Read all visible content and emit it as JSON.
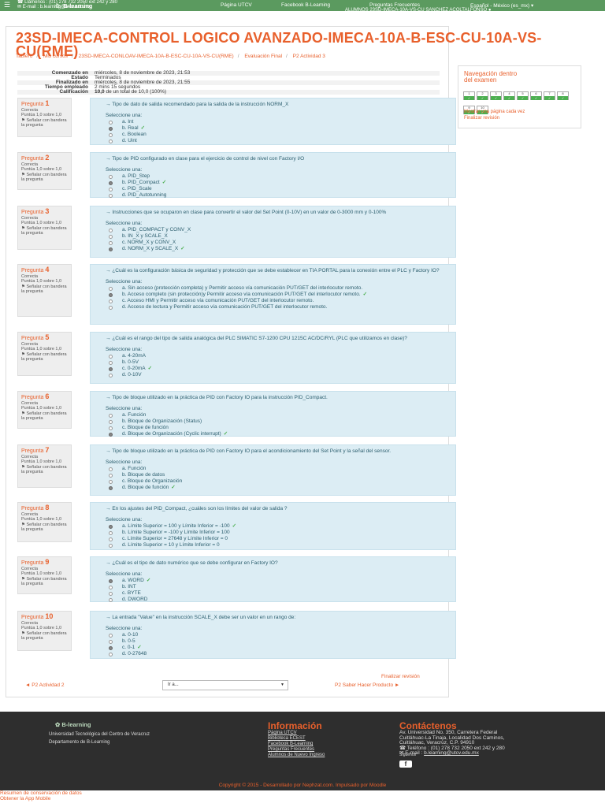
{
  "topbar": {
    "phone": "Llámenos : (01) 278 732 2050 ext 242 y 280",
    "email": "E-mail : b.learning@utcv.edu.mx",
    "brand": "B-learning",
    "nav": [
      "Página UTCV",
      "Facebook B-Learning",
      "Preguntas Frecuentes",
      "Español - México (es_mx)"
    ],
    "user": "ALUMNOS 23SD-IMECA-10A-VS-CU SANCHEZ ACOLTALFONSO"
  },
  "course_title": "23SD-IMECA-CONTROL LOGICO AVANZADO-IMECA-10A-B-ESC-CU-10A-VS-CU(RME)",
  "breadcrumbs": [
    "Tablero",
    "Mis cursos",
    "23SD-IMECA-CONLOAV-IMECA-10A-B-ESC-CU-10A-VS-CU(RME)",
    "Evaluación Final",
    "P2 Actividad 3"
  ],
  "summary": [
    {
      "k": "Comenzado en",
      "v": "miércoles, 8 de noviembre de 2023, 21:53"
    },
    {
      "k": "Estado",
      "v": "Terminados"
    },
    {
      "k": "Finalizado en",
      "v": "miércoles, 8 de noviembre de 2023, 21:55"
    },
    {
      "k": "Tiempo empleado",
      "v": "2 mins 15 segundos"
    },
    {
      "k": "Calificación",
      "v_bold": "10,0",
      "v": " de un total de 10,0 (100%)"
    }
  ],
  "question_meta": {
    "state": "Correcta",
    "points": "Puntúa 1,0 sobre 1,0",
    "flag": "Señalar con bandera la pregunta",
    "prompt": "Seleccione una:",
    "label": "Pregunta"
  },
  "questions": [
    {
      "no": "1",
      "text": "Tipo de dato de salida recomendado para la salida de la instrucción NORM_X",
      "answers": [
        "a. Int",
        "b. Real",
        "c. Boolean",
        "d. Uint"
      ],
      "selected": 1
    },
    {
      "no": "2",
      "text": "Tipo de PID configurado en clase para el ejercicio de control de nivel con Factory I/O",
      "answers": [
        "a. PID_Step",
        "b. PID_Compact",
        "c. PID_Scale",
        "d. PID_Autotunning"
      ],
      "selected": 1
    },
    {
      "no": "3",
      "text": "Instrucciones que se ocuparon en clase para convertir el valor del Set Point (0-10V) en un valor de 0-3000 mm y 0-100%",
      "answers": [
        "a. PID_COMPACT y CONV_X",
        "b. IN_X y SCALE_X",
        "c. NORM_X y CONV_X",
        "d. NORM_X y SCALE_X"
      ],
      "selected": 3
    },
    {
      "no": "4",
      "text": "¿Cuál es la configuración básica de seguridad y protección que se debe establecer en TIA PORTAL para la conexión entre el PLC y Factory IO?",
      "answers": [
        "a. Sin acceso (protección completa) y Permitir acceso vía comunicación PUT/GET del interlocutor remoto.",
        "b. Acceso completo (sin protección)y Permitir acceso vía comunicación PUT/GET del interlocutor remoto.",
        "c. Acceso HMI y Permitir acceso vía comunicación PUT/GET del interlocutor remoto.",
        "d. Acceso de lectura y Permitir acceso vía comunicación PUT/GET del interlocutor remoto."
      ],
      "selected": 1
    },
    {
      "no": "5",
      "text": "¿Cuál es el rango del tipo de salida analógica del PLC SIMATIC S7-1200 CPU 1215C AC/DC/RYL (PLC que utilizamos en clase)?",
      "answers": [
        "a. 4-20mA",
        "b. 0-5V",
        "c. 0-20mA",
        "d. 0-10V"
      ],
      "selected": 2
    },
    {
      "no": "6",
      "text": "Tipo de bloque utilizado en la práctica de PID con Factory IO para la instrucción PID_Compact.",
      "answers": [
        "a. Función",
        "b. Bloque de Organización (Status)",
        "c. Bloque de función",
        "d. Bloque de Organización (Cyclic interrupt)"
      ],
      "selected": 3
    },
    {
      "no": "7",
      "text": "Tipo de bloque utilizado en la práctica de PID con Factory IO para el acondicionamiento del Set Point y la señal del sensor.",
      "answers": [
        "a. Función",
        "b. Bloque de datos",
        "c. Bloque de Organización",
        "d. Bloque de función"
      ],
      "selected": 3
    },
    {
      "no": "8",
      "text": "En los ajustes del PID_Compact, ¿cuáles son los límites del valor de salida ?",
      "answers": [
        "a. Límite Superior = 100 y Límite Inferior = -100",
        "b. Límite Superior = -100 y Límite Inferior = 100",
        "c. Límite Superior = 27648 y Límite Inferior = 0",
        "d. Límite Superior = 10 y Límite Inferior = 0"
      ],
      "selected": 0
    },
    {
      "no": "9",
      "text": "¿Cuál es el tipo de dato numérico que se debe configurar en Factory IO?",
      "answers": [
        "a. WORD",
        "b. INT",
        "c. BYTE",
        "d. DWORD"
      ],
      "selected": 0
    },
    {
      "no": "10",
      "text": "La entrada \"Value\" en la instrucción SCALE_X debe ser un valor en un rango de:",
      "answers": [
        "a. 0-10",
        "b. 0-5",
        "c. 0-1",
        "d. 0-27648"
      ],
      "selected": 2
    }
  ],
  "quiz_nav": {
    "title": "Navegación dentro del examen",
    "buttons": [
      "1",
      "2",
      "3",
      "4",
      "5",
      "6",
      "7",
      "8",
      "9",
      "10"
    ],
    "show_one_page": "Mostrar una página cada vez",
    "finish_review": "Finalizar revisión"
  },
  "bottom_nav": {
    "finish_review": "Finalizar revisión",
    "prev": "◄ P2 Actividad 2",
    "jump": "Ir a...",
    "next": "P2 Saber Hacer Producto ►"
  },
  "footer": {
    "brand": "B-learning",
    "uni": "Universidad Tecnológica del Centro de Veracruz",
    "dept": "Departamento de B-Learning",
    "info_title": "Información",
    "info_links": [
      "Página UTCV",
      "Biblioteca ECEST",
      "Facebook B-Learning",
      "Preguntas Frecuentes",
      "Alumnos de Nuevo Ingreso"
    ],
    "contact_title": "Contáctenos",
    "address": [
      "Av. Universidad No. 350, Carretera Federal",
      "Cuitláhuac-La Tinaja, Localidad Dos Caminos,",
      "Cuitláhuac, Veracruz, C.P. 94910"
    ],
    "phone": "Teléfono : (01) 278 732 2050 ext 242 y 280",
    "email_label": "E-mail : ",
    "email": "b.learning@utcv.edu.mx",
    "follow": "Síguenos",
    "copyright": "Copyright © 2015 - Desarrollado por Nephzat.com. Impulsado por Moodle"
  },
  "bottom_links": [
    "Resumen de conservación de datos",
    "Obtener la App Mobile"
  ],
  "colors": {
    "accent": "#e8602c",
    "green": "#5b9a5f",
    "answer_bg": "#dcedf4",
    "footer_bg": "#2e2e2e"
  }
}
